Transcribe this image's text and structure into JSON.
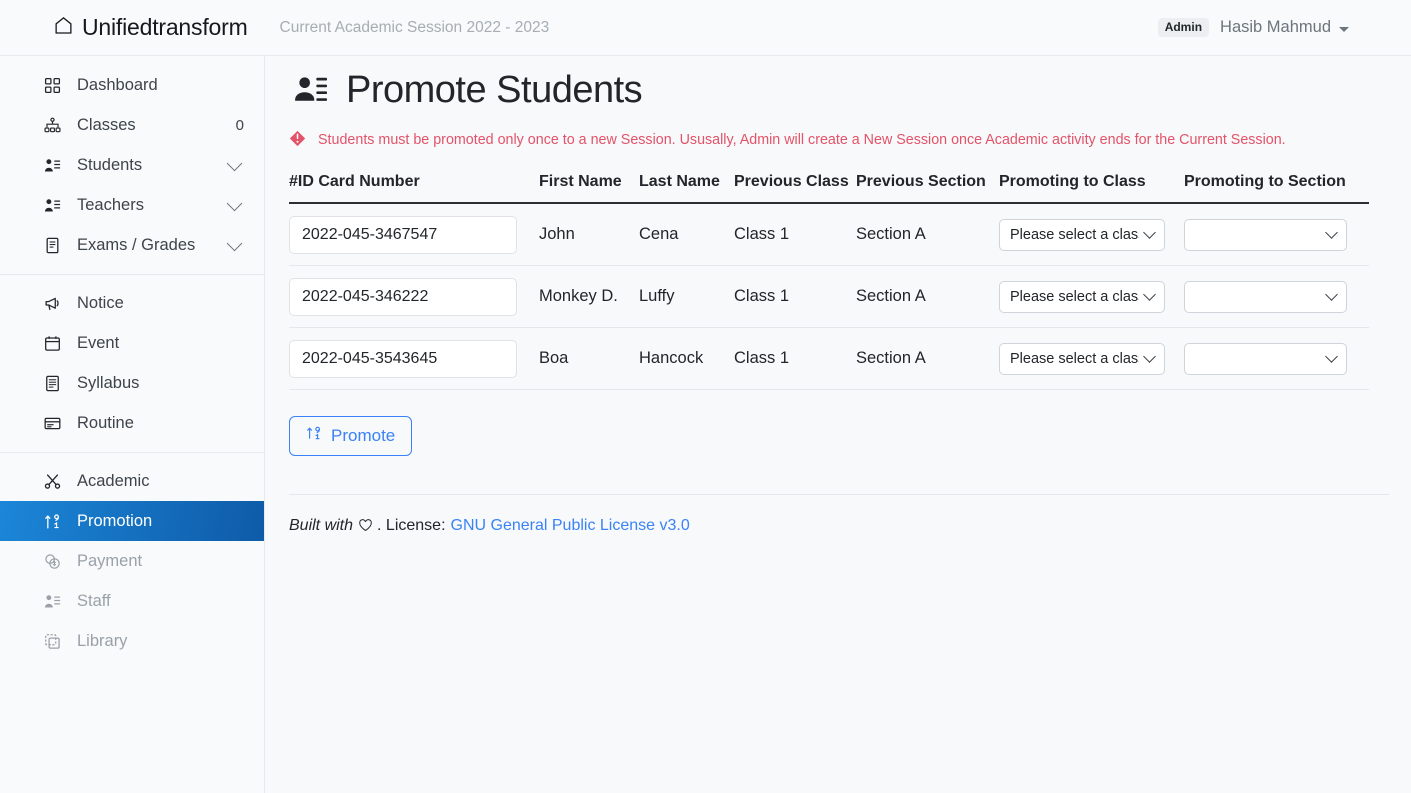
{
  "navbar": {
    "brand": "Unifiedtransform",
    "brand_icon": "home-icon",
    "session": "Current Academic Session 2022 - 2023",
    "role_badge": "Admin",
    "user_name": "Hasib Mahmud",
    "caret_icon": "caret-down-icon"
  },
  "watermark": "Unifiedtransform",
  "sidebar": {
    "items": [
      {
        "label": "Dashboard",
        "icon": "grid-icon",
        "trailing": "",
        "chevron": false,
        "active": false,
        "muted": false
      },
      {
        "label": "Classes",
        "icon": "diagram-icon",
        "trailing": "0",
        "chevron": false,
        "active": false,
        "muted": false
      },
      {
        "label": "Students",
        "icon": "person-list-icon",
        "trailing": "",
        "chevron": true,
        "active": false,
        "muted": false
      },
      {
        "label": "Teachers",
        "icon": "person-list-icon",
        "trailing": "",
        "chevron": true,
        "active": false,
        "muted": false
      },
      {
        "label": "Exams / Grades",
        "icon": "journal-icon",
        "trailing": "",
        "chevron": true,
        "active": false,
        "muted": false
      },
      {
        "label": "Notice",
        "icon": "megaphone-icon",
        "trailing": "",
        "chevron": false,
        "active": false,
        "muted": false
      },
      {
        "label": "Event",
        "icon": "calendar-icon",
        "trailing": "",
        "chevron": false,
        "active": false,
        "muted": false
      },
      {
        "label": "Syllabus",
        "icon": "file-text-icon",
        "trailing": "",
        "chevron": false,
        "active": false,
        "muted": false
      },
      {
        "label": "Routine",
        "icon": "card-list-icon",
        "trailing": "",
        "chevron": false,
        "active": false,
        "muted": false
      },
      {
        "label": "Academic",
        "icon": "scissors-icon",
        "trailing": "",
        "chevron": false,
        "active": false,
        "muted": false
      },
      {
        "label": "Promotion",
        "icon": "sort-numeric-up-icon",
        "trailing": "",
        "chevron": false,
        "active": true,
        "muted": false
      },
      {
        "label": "Payment",
        "icon": "coin-icon",
        "trailing": "",
        "chevron": false,
        "active": false,
        "muted": true
      },
      {
        "label": "Staff",
        "icon": "person-list-icon",
        "trailing": "",
        "chevron": false,
        "active": false,
        "muted": true
      },
      {
        "label": "Library",
        "icon": "copy-icon",
        "trailing": "",
        "chevron": false,
        "active": false,
        "muted": true
      }
    ],
    "separator_after_index": [
      4,
      8
    ]
  },
  "page": {
    "title": "Promote Students",
    "title_icon": "person-lines-icon",
    "alert_icon": "exclamation-diamond-icon",
    "alert_text": "Students must be promoted only once to a new Session. Ususally, Admin will create a New Session once Academic activity ends for the Current Session.",
    "alert_color": "#e3536a"
  },
  "table": {
    "headers": [
      "#ID Card Number",
      "First Name",
      "Last Name",
      "Previous Class",
      "Previous Section",
      "Promoting to Class",
      "Promoting to Section"
    ],
    "rows": [
      {
        "id_card": "2022-045-3467547",
        "first_name": "John",
        "last_name": "Cena",
        "previous_class": "Class 1",
        "previous_section": "Section A",
        "promoting_class": "Please select a class",
        "promoting_section": ""
      },
      {
        "id_card": "2022-045-346222",
        "first_name": "Monkey D.",
        "last_name": "Luffy",
        "previous_class": "Class 1",
        "previous_section": "Section A",
        "promoting_class": "Please select a class",
        "promoting_section": ""
      },
      {
        "id_card": "2022-045-3543645",
        "first_name": "Boa",
        "last_name": "Hancock",
        "previous_class": "Class 1",
        "previous_section": "Section A",
        "promoting_class": "Please select a class",
        "promoting_section": ""
      }
    ]
  },
  "actions": {
    "promote_label": "Promote",
    "promote_icon": "sort-numeric-up-icon",
    "promote_color": "#3b82f6"
  },
  "footer": {
    "built_with": "Built with",
    "heart_icon": "heart-icon",
    "license_prefix": ". License:",
    "license_link": "GNU General Public License v3.0",
    "link_color": "#3b82f6"
  }
}
